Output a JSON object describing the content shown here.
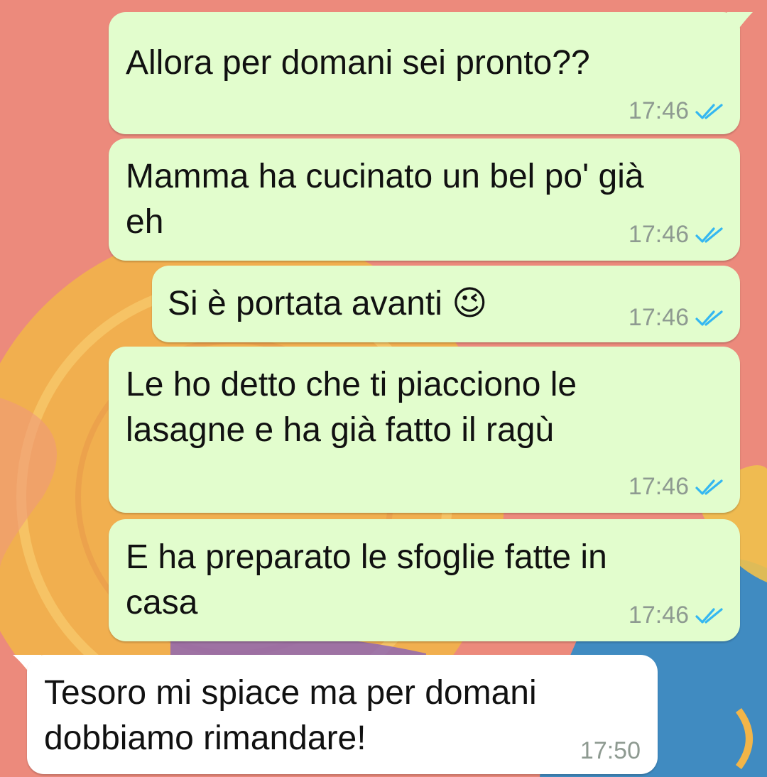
{
  "chat": {
    "messages": [
      {
        "direction": "outgoing",
        "lines": [
          "Allora per domani sei pronto??"
        ],
        "time": "17:46",
        "status": "read",
        "status_icon": "double-check-icon"
      },
      {
        "direction": "outgoing",
        "lines": [
          "Mamma ha cucinato un bel po' già",
          "eh"
        ],
        "time": "17:46",
        "status": "read",
        "status_icon": "double-check-icon"
      },
      {
        "direction": "outgoing",
        "lines": [
          "Si è portata avanti"
        ],
        "emoji": "😉",
        "emoji_icon": "winking-face-emoji-icon",
        "time": "17:46",
        "status": "read",
        "status_icon": "double-check-icon"
      },
      {
        "direction": "outgoing",
        "lines": [
          "Le ho detto che ti piacciono le",
          "lasagne e ha già fatto il ragù"
        ],
        "time": "17:46",
        "status": "read",
        "status_icon": "double-check-icon"
      },
      {
        "direction": "outgoing",
        "lines": [
          "E ha preparato le sfoglie fatte in",
          "casa"
        ],
        "time": "17:46",
        "status": "read",
        "status_icon": "double-check-icon"
      },
      {
        "direction": "incoming",
        "lines": [
          "Tesoro mi spiace ma per domani",
          "dobbiamo rimandare!"
        ],
        "time": "17:50"
      }
    ]
  },
  "colors": {
    "wallpaper_base": "#ec8a7c",
    "outgoing_bubble": "#e2fdcd",
    "incoming_bubble": "#ffffff",
    "read_ticks": "#34b7f1",
    "timestamp": "#8e9a91"
  }
}
